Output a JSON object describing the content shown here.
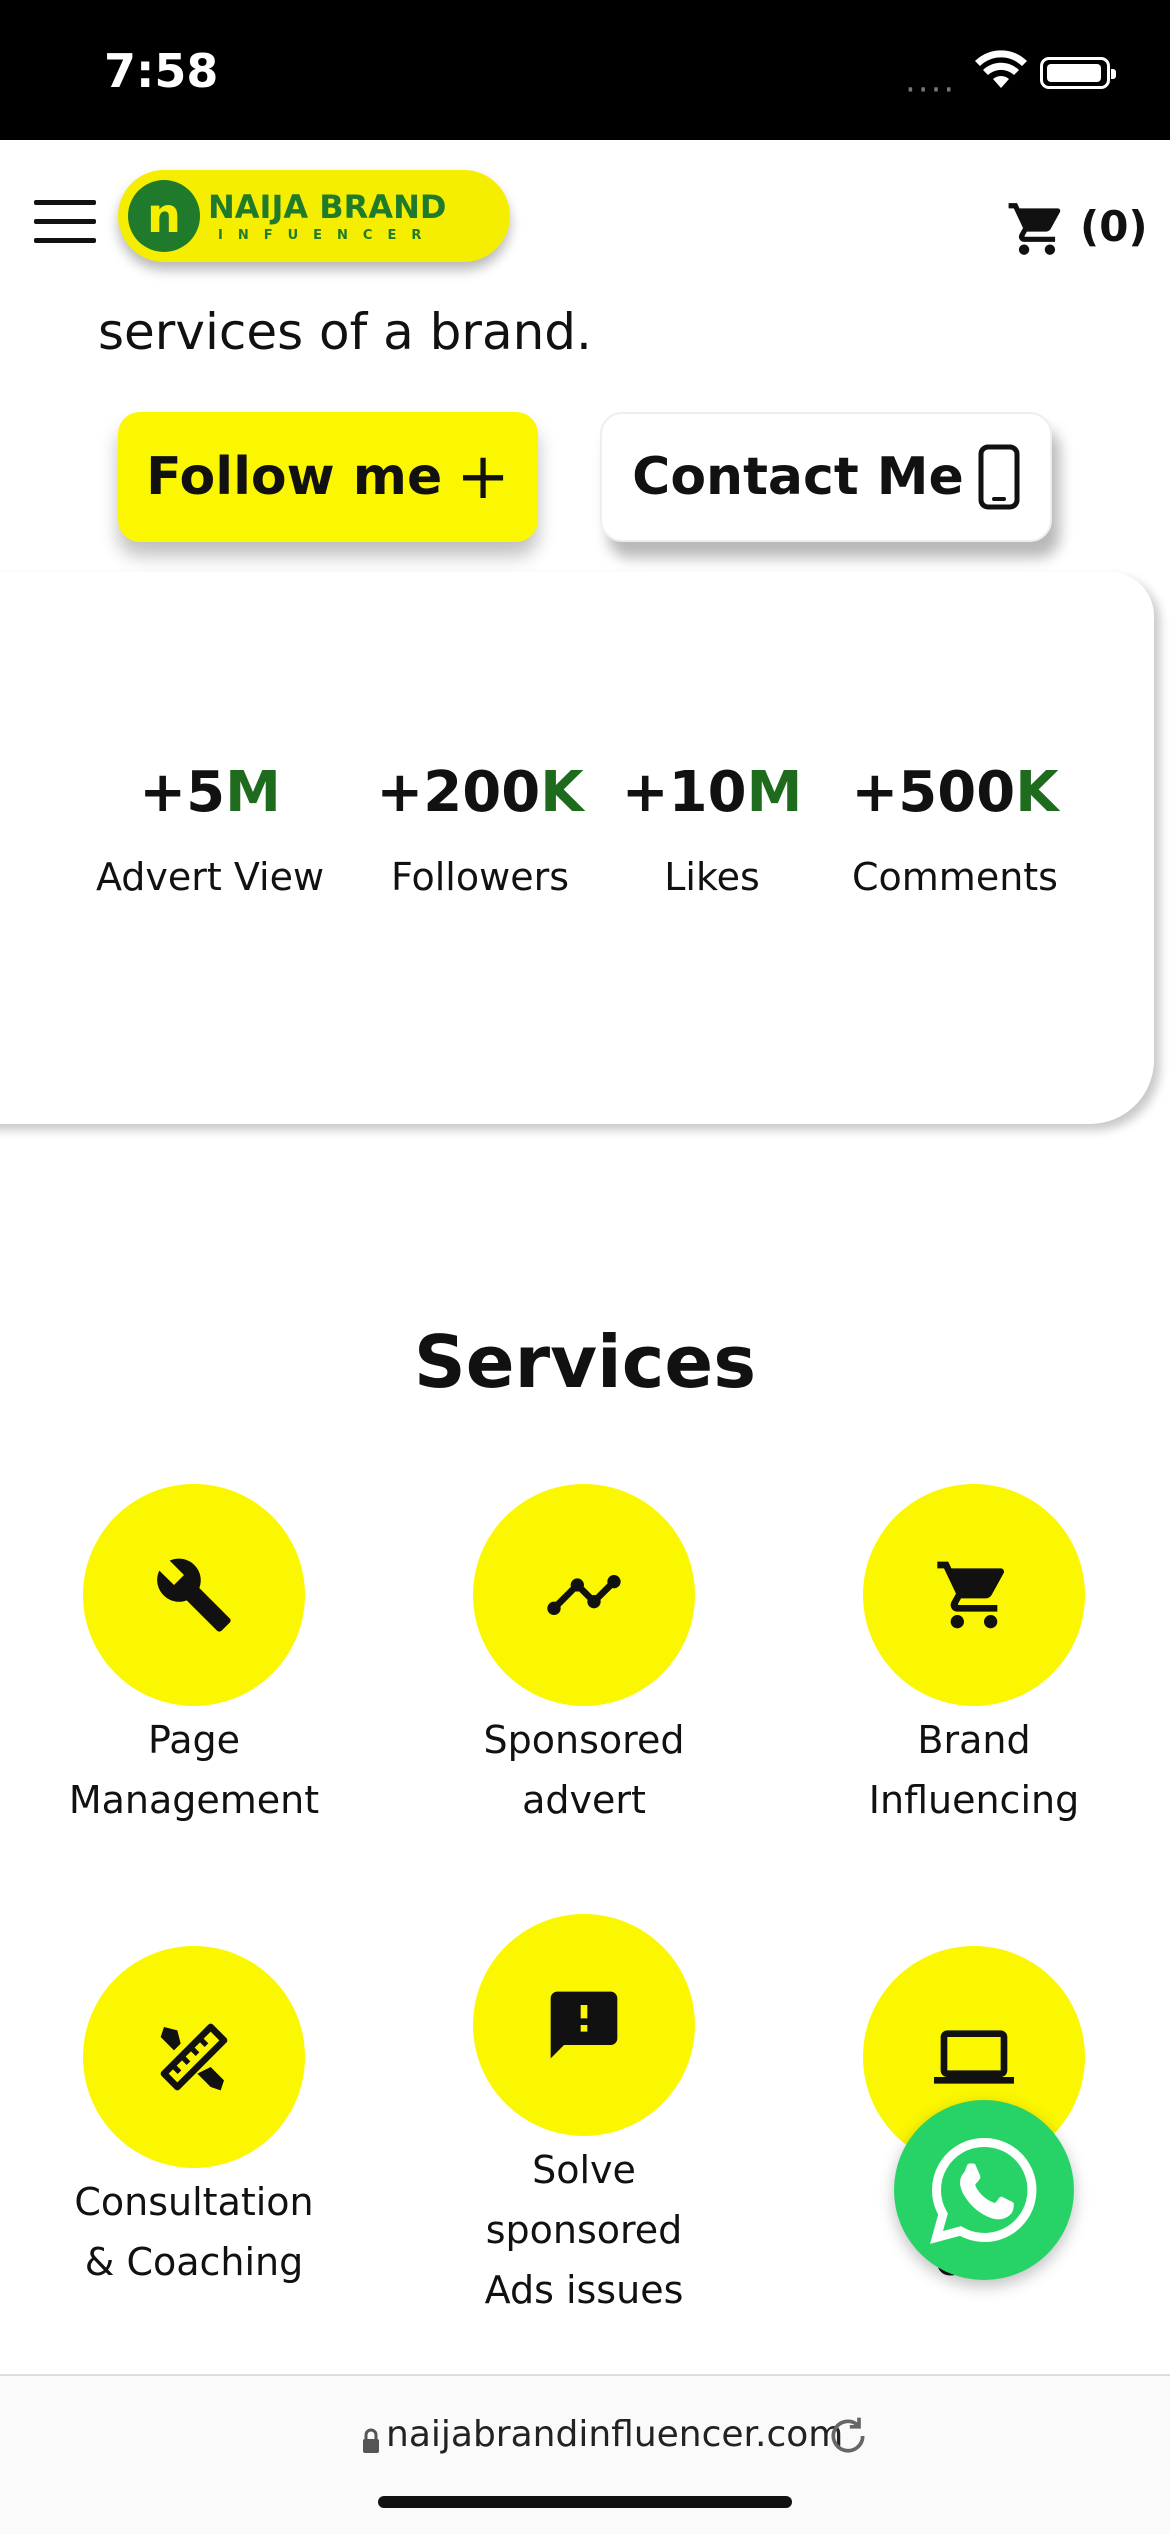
{
  "status_bar": {
    "time": "7:58",
    "signal": "····"
  },
  "header": {
    "logo_mark": "n",
    "logo_title": "NAIJA BRAND",
    "logo_subtitle": "INFUENCER",
    "cart_count": "(0)"
  },
  "hero": {
    "partial_text": "services of a brand.",
    "follow_label": "Follow me",
    "follow_icon": "+",
    "contact_label": "Contact Me"
  },
  "stats": [
    {
      "prefix": "+5",
      "suffix": "M",
      "label": "Advert View"
    },
    {
      "prefix": "+200",
      "suffix": "K",
      "label": "Followers"
    },
    {
      "prefix": "+10",
      "suffix": "M",
      "label": "Likes"
    },
    {
      "prefix": "+500",
      "suffix": "K",
      "label": "Comments"
    }
  ],
  "services": {
    "title": "Services",
    "items": [
      {
        "label_line1": "Page",
        "label_line2": "Management",
        "label_line3": "",
        "icon": "wrench-icon"
      },
      {
        "label_line1": "Sponsored",
        "label_line2": "advert",
        "label_line3": "",
        "icon": "trend-line-icon"
      },
      {
        "label_line1": "Brand",
        "label_line2": "Influencing",
        "label_line3": "",
        "icon": "cart-icon"
      },
      {
        "label_line1": "Consultation",
        "label_line2": "& Coaching",
        "label_line3": "",
        "icon": "design-tools-icon"
      },
      {
        "label_line1": "Solve",
        "label_line2": "sponsored",
        "label_line3": "Ads issues",
        "icon": "feedback-icon"
      },
      {
        "label_line1": "",
        "label_line2": "Cr      n",
        "label_line3": "",
        "icon": "monitor-icon"
      }
    ]
  },
  "browser": {
    "url": "naijabrandinfluencer.com"
  },
  "colors": {
    "accent_yellow": "#fbf700",
    "brand_green": "#1e6b1e",
    "whatsapp_green": "#27d366"
  }
}
